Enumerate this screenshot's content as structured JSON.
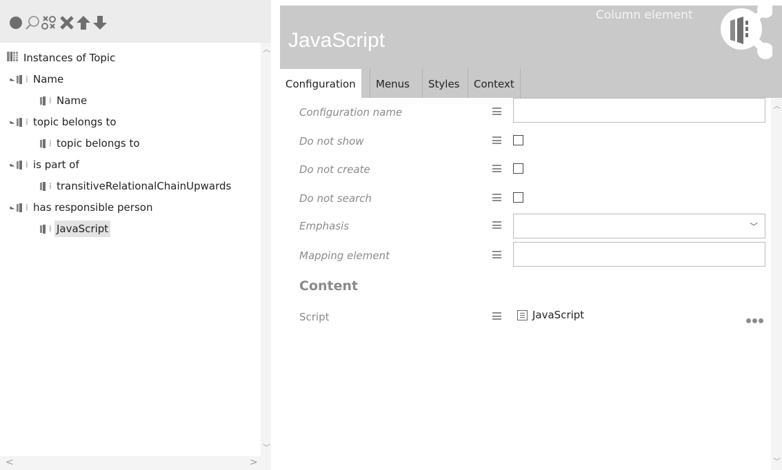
{
  "toolbar": {
    "icons": [
      "circle-icon",
      "search-icon",
      "clear-filter-icon",
      "delete-icon",
      "move-up-icon",
      "move-down-icon"
    ]
  },
  "tree": {
    "root": "Instances of Topic",
    "items": [
      {
        "label": "Name",
        "level": 1,
        "expandable": true
      },
      {
        "label": "Name",
        "level": 2,
        "expandable": false
      },
      {
        "label": "topic belongs to",
        "level": 1,
        "expandable": true
      },
      {
        "label": "topic belongs to",
        "level": 2,
        "expandable": false
      },
      {
        "label": "is part of",
        "level": 1,
        "expandable": true
      },
      {
        "label": "transitiveRelationalChainUpwards",
        "level": 2,
        "expandable": false
      },
      {
        "label": "has responsible person",
        "level": 1,
        "expandable": true
      },
      {
        "label": "JavaScript",
        "level": 2,
        "expandable": false,
        "selected": true
      }
    ]
  },
  "header": {
    "title": "JavaScript",
    "subtitle": "Column element"
  },
  "tabs": [
    {
      "label": "Configuration",
      "active": true
    },
    {
      "label": "Menus",
      "active": false
    },
    {
      "label": "Styles",
      "active": false
    },
    {
      "label": "Context",
      "active": false
    }
  ],
  "form": {
    "configuration_name": {
      "label": "Configuration name",
      "value": ""
    },
    "do_not_show": {
      "label": "Do not show",
      "checked": false
    },
    "do_not_create": {
      "label": "Do not create",
      "checked": false
    },
    "do_not_search": {
      "label": "Do not search",
      "checked": false
    },
    "emphasis": {
      "label": "Emphasis",
      "value": ""
    },
    "mapping_element": {
      "label": "Mapping element",
      "value": ""
    }
  },
  "content": {
    "heading": "Content",
    "script_label": "Script",
    "script_value": "JavaScript"
  },
  "colors": {
    "header_bg": "#c9c9c9",
    "toolbar_bg": "#ececec",
    "label_gray": "#8a8a8a",
    "selected_bg": "#e3e3e3"
  }
}
